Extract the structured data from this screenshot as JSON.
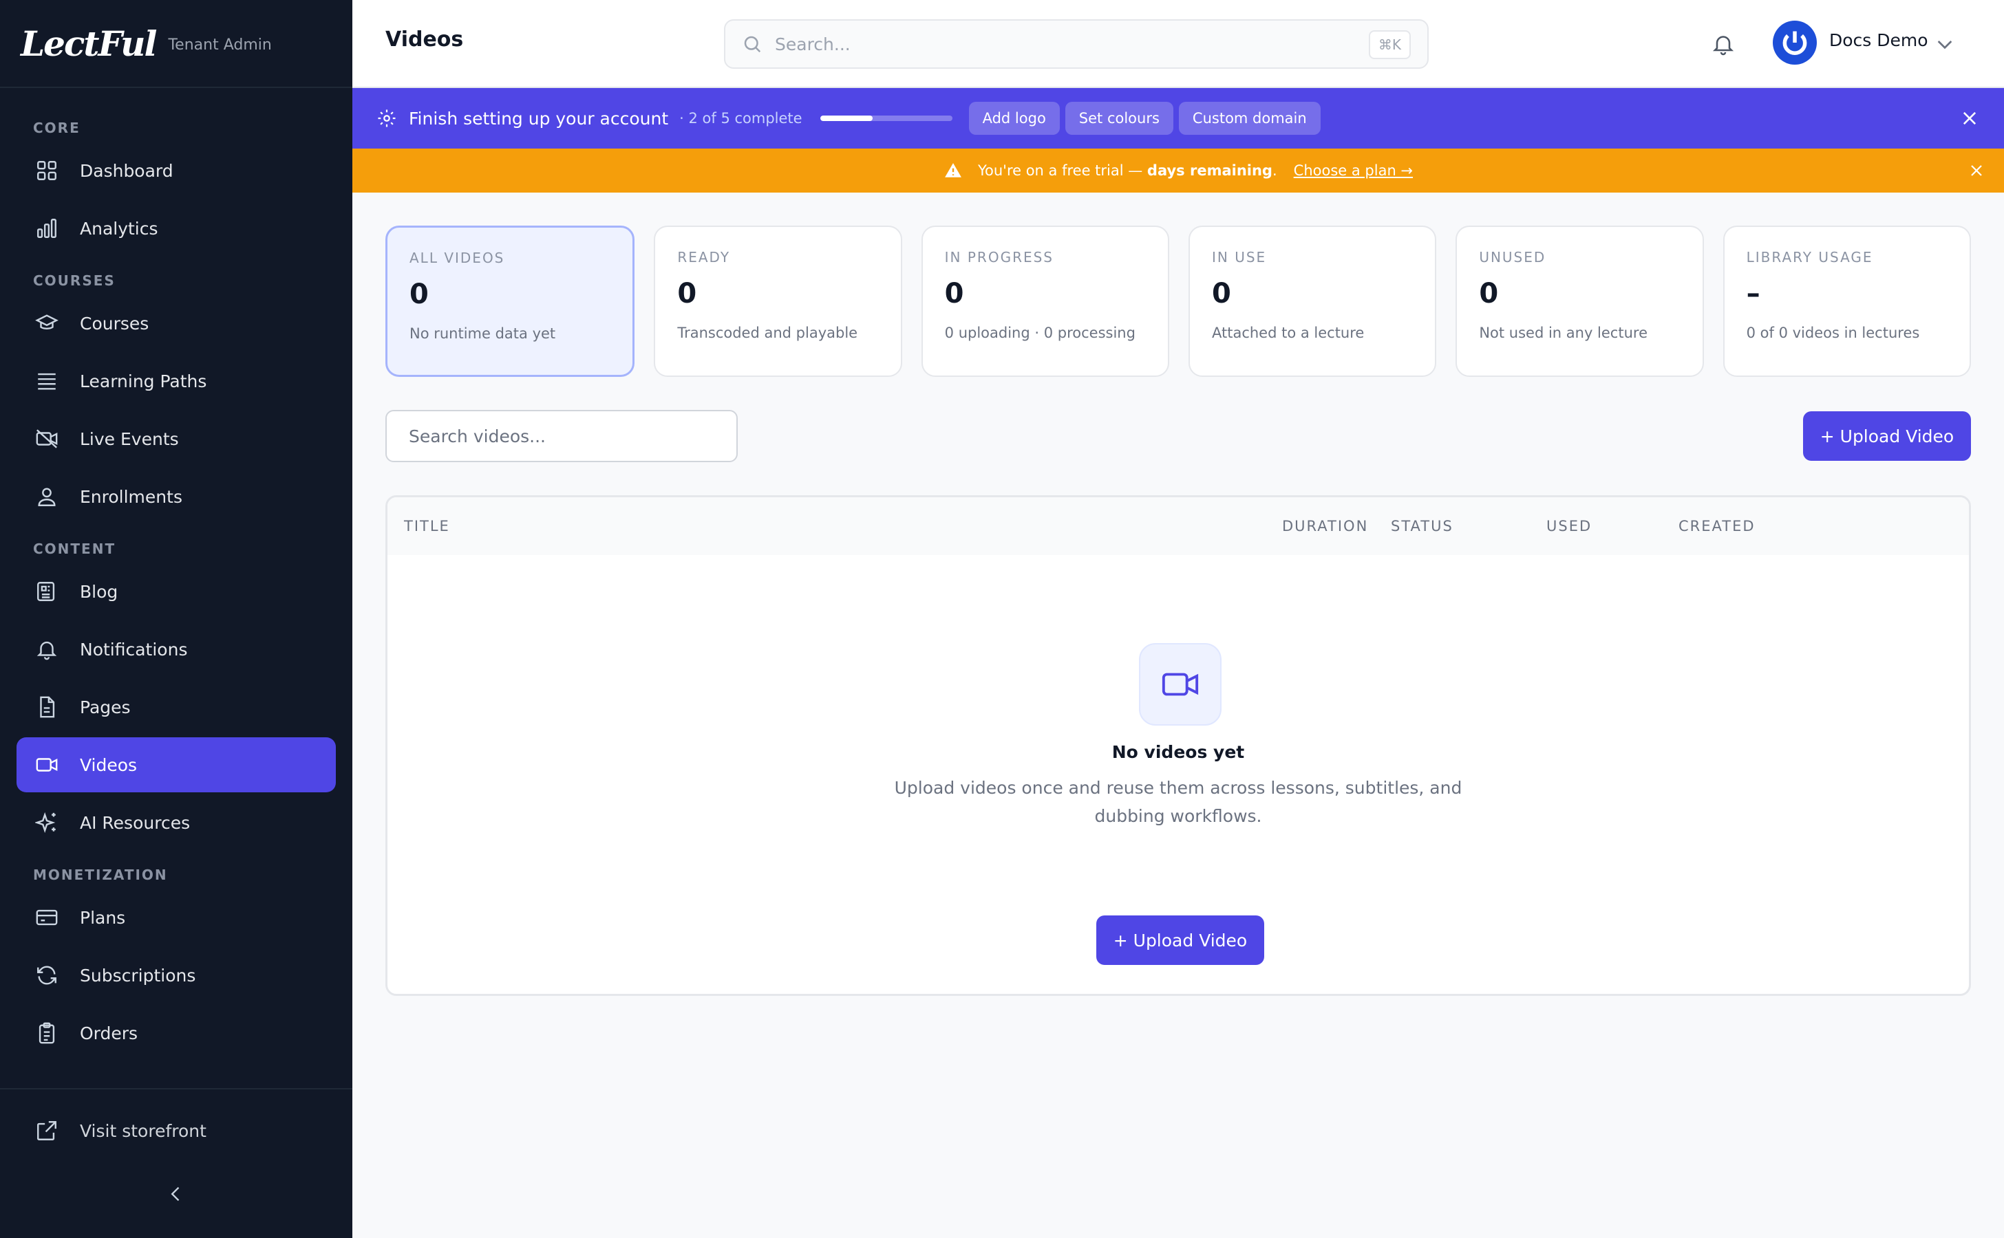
{
  "brand": {
    "logo": "LectFul",
    "subtitle": "Tenant Admin"
  },
  "sidebar": {
    "sections": [
      {
        "title": "CORE",
        "items": [
          {
            "label": "Dashboard",
            "icon": "dashboard-icon"
          },
          {
            "label": "Analytics",
            "icon": "analytics-icon"
          }
        ]
      },
      {
        "title": "COURSES",
        "items": [
          {
            "label": "Courses",
            "icon": "graduation-cap-icon"
          },
          {
            "label": "Learning Paths",
            "icon": "list-icon"
          },
          {
            "label": "Live Events",
            "icon": "video-off-icon"
          },
          {
            "label": "Enrollments",
            "icon": "user-icon"
          }
        ]
      },
      {
        "title": "CONTENT",
        "items": [
          {
            "label": "Blog",
            "icon": "newspaper-icon"
          },
          {
            "label": "Notifications",
            "icon": "bell-icon"
          },
          {
            "label": "Pages",
            "icon": "file-icon"
          },
          {
            "label": "Videos",
            "icon": "video-icon",
            "active": true
          },
          {
            "label": "AI Resources",
            "icon": "sparkles-icon"
          }
        ]
      },
      {
        "title": "MONETIZATION",
        "items": [
          {
            "label": "Plans",
            "icon": "credit-card-icon"
          },
          {
            "label": "Subscriptions",
            "icon": "refresh-icon"
          },
          {
            "label": "Orders",
            "icon": "clipboard-icon"
          }
        ]
      }
    ],
    "footer": {
      "visit_label": "Visit storefront"
    }
  },
  "header": {
    "title": "Videos",
    "search_placeholder": "Search...",
    "search_shortcut": "⌘K",
    "user_name": "Docs Demo"
  },
  "setup_banner": {
    "title": "Finish setting up your account",
    "progress_text": "· 2 of 5 complete",
    "progress_fraction": 0.4,
    "chips": [
      "Add logo",
      "Set colours",
      "Custom domain"
    ]
  },
  "trial_banner": {
    "text_before": "You're on a free trial — ",
    "text_bold": "days remaining",
    "text_after": ".",
    "link": "Choose a plan →"
  },
  "stats": [
    {
      "label": "ALL VIDEOS",
      "value": "0",
      "sub": "No runtime data yet",
      "active": true
    },
    {
      "label": "READY",
      "value": "0",
      "sub": "Transcoded and playable"
    },
    {
      "label": "IN PROGRESS",
      "value": "0",
      "sub": "0 uploading · 0 processing"
    },
    {
      "label": "IN USE",
      "value": "0",
      "sub": "Attached to a lecture"
    },
    {
      "label": "UNUSED",
      "value": "0",
      "sub": "Not used in any lecture"
    },
    {
      "label": "LIBRARY USAGE",
      "value": "–",
      "sub": "0 of 0 videos in lectures"
    }
  ],
  "toolbar": {
    "search_placeholder": "Search videos...",
    "upload_label": "+ Upload Video"
  },
  "table": {
    "columns": [
      "TITLE",
      "DURATION",
      "STATUS",
      "USED",
      "CREATED"
    ],
    "empty_title": "No videos yet",
    "empty_desc": "Upload videos once and reuse them across lessons, subtitles, and dubbing workflows.",
    "empty_button": "+ Upload Video"
  },
  "colors": {
    "sidebar_bg": "#111827",
    "accent": "#4f46e5",
    "setup_bg": "#5046e5",
    "trial_bg": "#f59e0b"
  }
}
